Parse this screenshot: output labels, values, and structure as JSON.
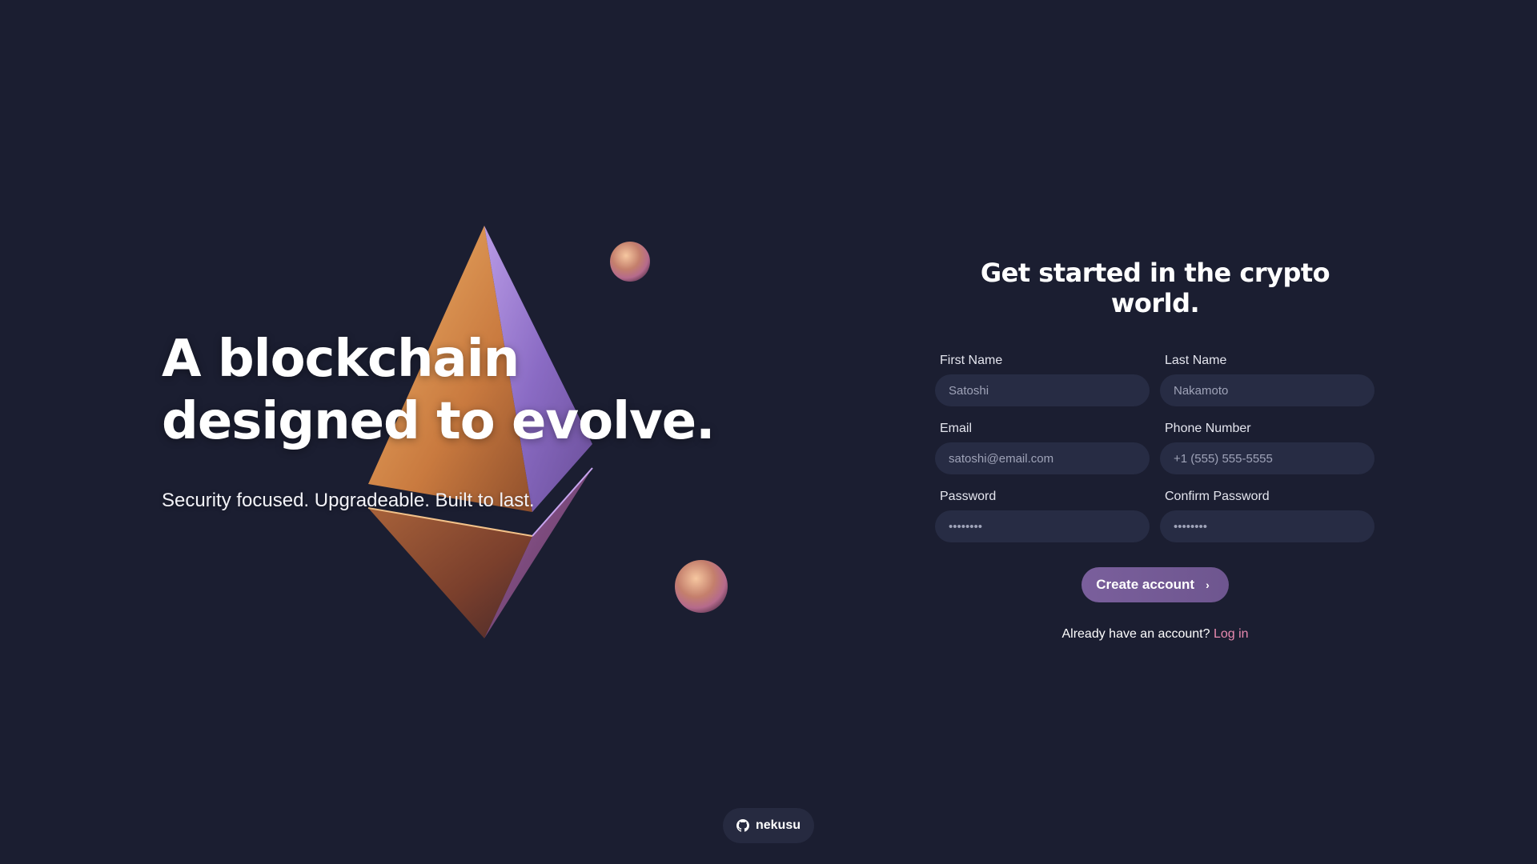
{
  "hero": {
    "headline": "A blockchain designed to evolve.",
    "subline": "Security focused. Upgradeable. Built to last."
  },
  "form": {
    "title": "Get started in the crypto world.",
    "fields": [
      {
        "label": "First Name",
        "placeholder": "Satoshi"
      },
      {
        "label": "Last Name",
        "placeholder": "Nakamoto"
      },
      {
        "label": "Email",
        "placeholder": "satoshi@email.com"
      },
      {
        "label": "Phone Number",
        "placeholder": "+1 (555) 555-5555"
      },
      {
        "label": "Password",
        "placeholder": "••••••••"
      },
      {
        "label": "Confirm Password",
        "placeholder": "••••••••"
      }
    ],
    "submit_label": "Create account",
    "login_prompt": "Already have an account?",
    "login_link": "Log in"
  },
  "footer": {
    "github_label": "nekusu",
    "icon": "github-icon"
  },
  "colors": {
    "background": "#1b1e31",
    "input_bg": "#272c44",
    "button": "#7a5f9c",
    "link": "#e98ab0"
  }
}
